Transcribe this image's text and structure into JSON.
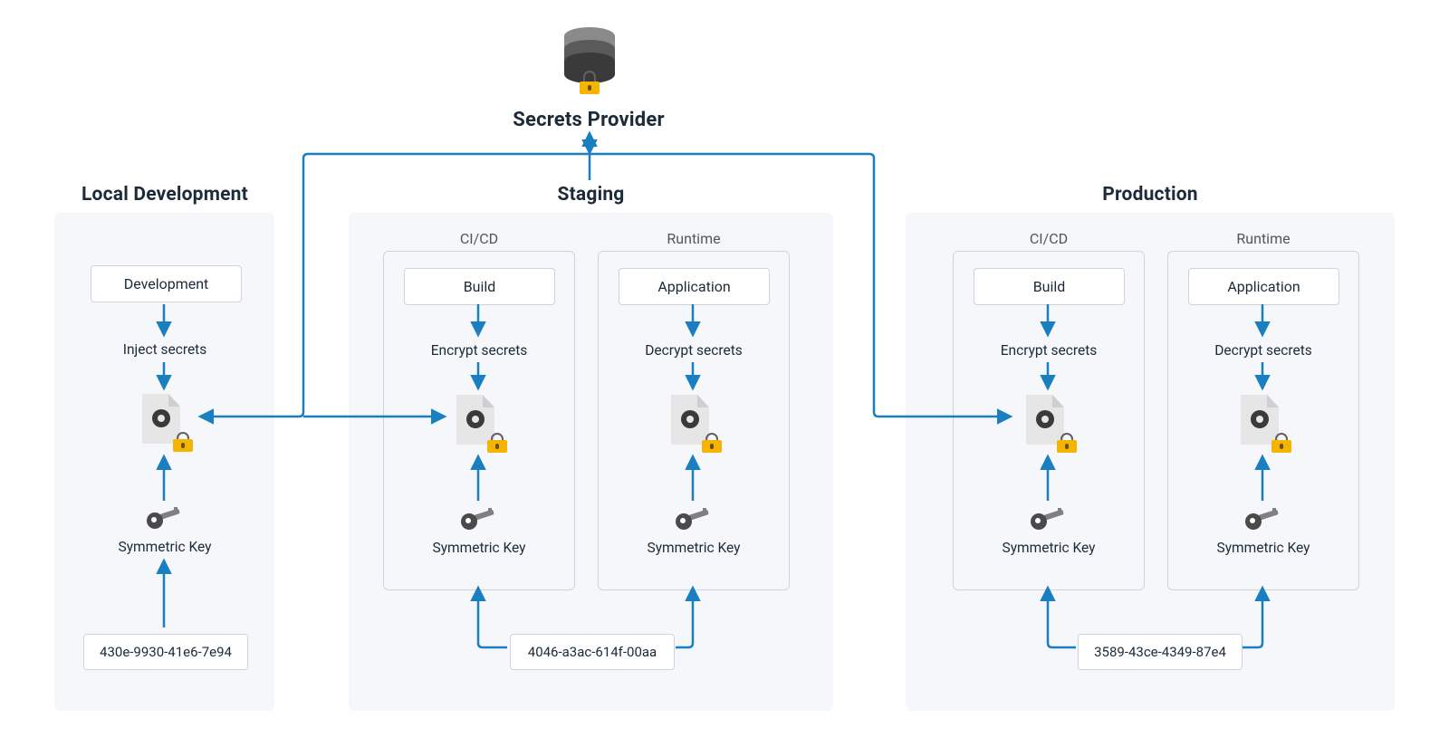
{
  "header": {
    "secrets_provider": "Secrets Provider"
  },
  "environments": {
    "local": {
      "title": "Local Development",
      "box": "Development",
      "action": "Inject secrets",
      "key_label": "Symmetric Key",
      "key_value": "430e-9930-41e6-7e94"
    },
    "staging": {
      "title": "Staging",
      "cicd": {
        "title": "CI/CD",
        "box": "Build",
        "action": "Encrypt secrets",
        "key_label": "Symmetric Key"
      },
      "runtime": {
        "title": "Runtime",
        "box": "Application",
        "action": "Decrypt secrets",
        "key_label": "Symmetric Key"
      },
      "key_value": "4046-a3ac-614f-00aa"
    },
    "production": {
      "title": "Production",
      "cicd": {
        "title": "CI/CD",
        "box": "Build",
        "action": "Encrypt secrets",
        "key_label": "Symmetric Key"
      },
      "runtime": {
        "title": "Runtime",
        "box": "Application",
        "action": "Decrypt secrets",
        "key_label": "Symmetric Key"
      },
      "key_value": "3589-43ce-4349-87e4"
    }
  },
  "icons": {
    "database": "database-lock-icon",
    "config": "config-file-lock-icon",
    "key": "key-icon"
  }
}
